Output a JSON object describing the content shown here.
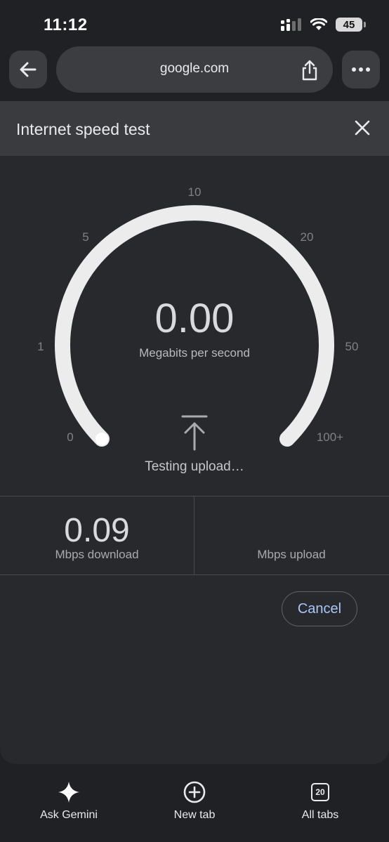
{
  "status_bar": {
    "time": "11:12",
    "battery": "45",
    "icons": [
      "signal-icon",
      "wifi-icon",
      "battery-icon"
    ]
  },
  "toolbar": {
    "url": "google.com",
    "icons": [
      "back-arrow-icon",
      "share-icon",
      "more-icon"
    ]
  },
  "widget": {
    "title": "Internet speed test",
    "gauge": {
      "scale_labels": [
        "0",
        "1",
        "5",
        "10",
        "20",
        "50",
        "100+"
      ],
      "value": "0.00",
      "unit": "Megabits per second",
      "status": "Testing upload…"
    },
    "results": {
      "download_value": "0.09",
      "download_label": "Mbps download",
      "upload_value": "",
      "upload_label": "Mbps upload"
    },
    "cancel_label": "Cancel"
  },
  "bottom_bar": {
    "items": [
      {
        "label": "Ask Gemini",
        "icon": "gemini-sparkle-icon"
      },
      {
        "label": "New tab",
        "icon": "plus-circle-icon"
      },
      {
        "label": "All tabs",
        "icon": "tab-count-icon",
        "count": "20"
      }
    ]
  },
  "colors": {
    "background": "#202124",
    "panel": "#28292c",
    "gauge_track": "#ececec",
    "accent": "#a8c7fa"
  }
}
